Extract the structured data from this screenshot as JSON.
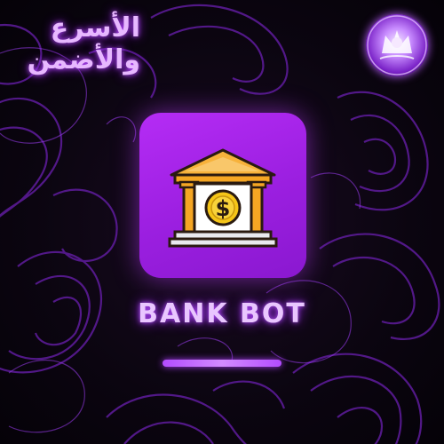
{
  "tagline": {
    "line1": "الأسرع",
    "line2": "والأضمن"
  },
  "title": "BANK BOT",
  "icons": {
    "app_icon": "bank-building-icon",
    "coin_symbol": "$",
    "brand_logo": "brand-logo"
  },
  "colors": {
    "accent": "#b52cf5",
    "glow": "#b34dff",
    "background": "#0b0510",
    "building_gold": "#f5a623",
    "roof_orange": "#f7b23b"
  }
}
